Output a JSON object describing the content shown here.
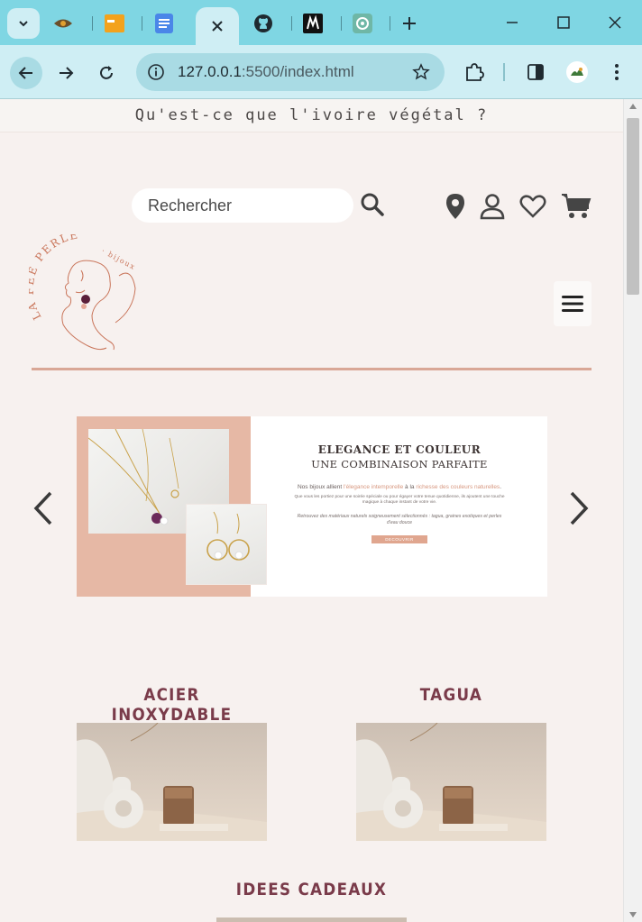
{
  "browser": {
    "tabs": [
      {
        "name": "tab-eye",
        "icon": "eye-icon"
      },
      {
        "name": "tab-orange",
        "icon": "orange-app-icon"
      },
      {
        "name": "tab-docs",
        "icon": "docs-icon"
      },
      {
        "name": "tab-active",
        "icon": "close-icon"
      },
      {
        "name": "tab-github",
        "icon": "github-icon"
      },
      {
        "name": "tab-m",
        "icon": "m-app-icon"
      },
      {
        "name": "tab-chatgpt",
        "icon": "chatgpt-icon"
      }
    ],
    "url_host": "127.0.0.1",
    "url_path": ":5500/index.html",
    "accent": "#7fd6e3",
    "toolbar_bg": "#cfeef4"
  },
  "page": {
    "announcement": "Qu'est-ce que l'ivoire végétal ?",
    "search_placeholder": "Rechercher",
    "logo": {
      "text": "LA FEE PERLE",
      "subtext": "· bijoux"
    },
    "slide": {
      "title": "ELEGANCE ET COULEUR",
      "subtitle": "UNE COMBINAISON PARFAITE",
      "para1_a": "Nos bijoux allient ",
      "para1_b": "l'élegance intemporelle",
      "para1_c": " à la ",
      "para1_d": "richesse des couleurs naturelles",
      "para1_e": ".",
      "para2": "Que vous les portiez pour une soirée spéciale ou pour égayer votre tenue quotidienne, ils ajoutent une touche magique à chaque instant de votre vie.",
      "para3": "Retrouvez des matériaux naturels soigneusement sélectionnés : tagua, graines exotiques et perles d'eau douce",
      "button": "DECOUVRIR"
    },
    "categories": [
      {
        "title": "ACIER INOXYDABLE"
      },
      {
        "title": "TAGUA"
      },
      {
        "title": "IDEES CADEAUX"
      }
    ],
    "colors": {
      "page_bg": "#f7f1ef",
      "category_title": "#7a3b4a",
      "accent_peach": "#e6b8a5",
      "divider": "#d9a796"
    }
  }
}
